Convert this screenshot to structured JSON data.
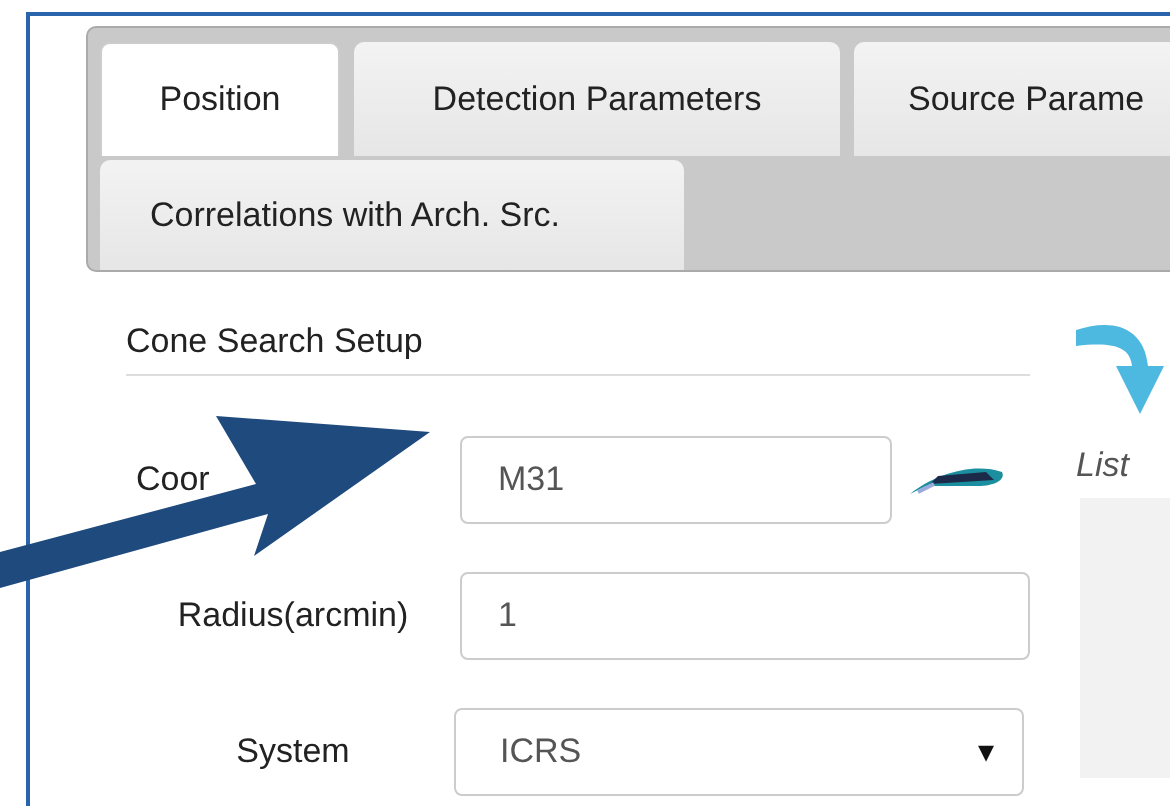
{
  "tabs": [
    {
      "label": "Position",
      "selected": true
    },
    {
      "label": "Detection Parameters",
      "selected": false
    },
    {
      "label": "Source Parame",
      "selected": false
    },
    {
      "label": "Correlations with Arch. Src.",
      "selected": false
    }
  ],
  "section_title": "Cone Search Setup",
  "fields": [
    {
      "kind": "resolver",
      "label": "Coor",
      "value": "M31"
    },
    {
      "kind": "text",
      "label": "Radius(arcmin)",
      "value": "1"
    },
    {
      "kind": "select",
      "label": "System",
      "value": "ICRS",
      "caret": "▾"
    }
  ],
  "right_panel": {
    "caption": "List"
  }
}
